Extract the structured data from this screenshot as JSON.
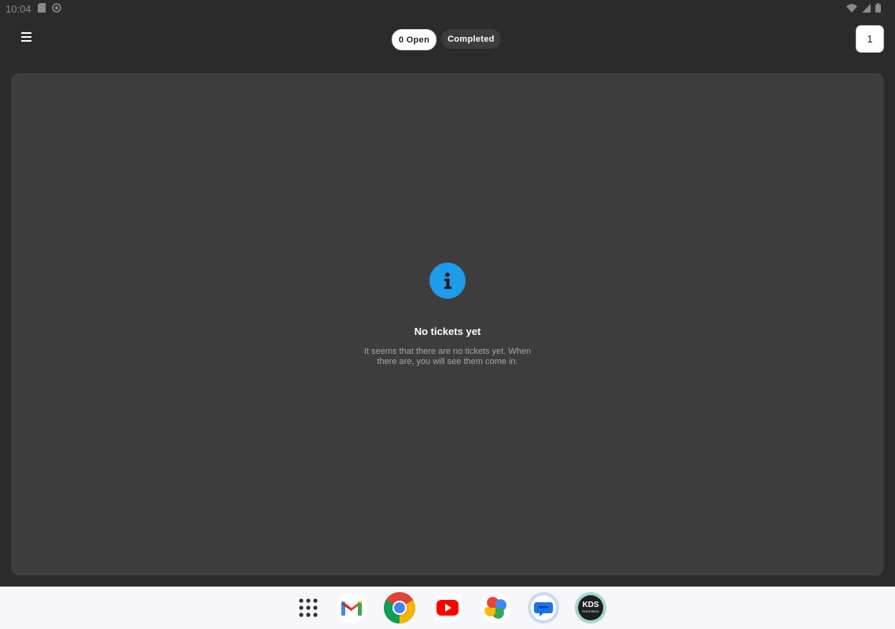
{
  "status_bar": {
    "time": "10:04"
  },
  "header": {
    "tabs": [
      {
        "label": "0 Open"
      },
      {
        "label": "Completed"
      }
    ],
    "count_button": "1"
  },
  "empty_state": {
    "title": "No tickets yet",
    "message": "It seems that there are no tickets yet. When there are, you will see them come in."
  },
  "taskbar": {
    "apps": [
      "apps-grid",
      "Gmail",
      "Chrome",
      "YouTube",
      "Photos",
      "Messages",
      "KDS Flexybox"
    ],
    "kds_label": "KDS",
    "kds_sublabel": "FLEXYBOX"
  },
  "colors": {
    "accent": "#1e9be9",
    "panel": "#3d3d3d",
    "background": "#2b2b2b"
  }
}
